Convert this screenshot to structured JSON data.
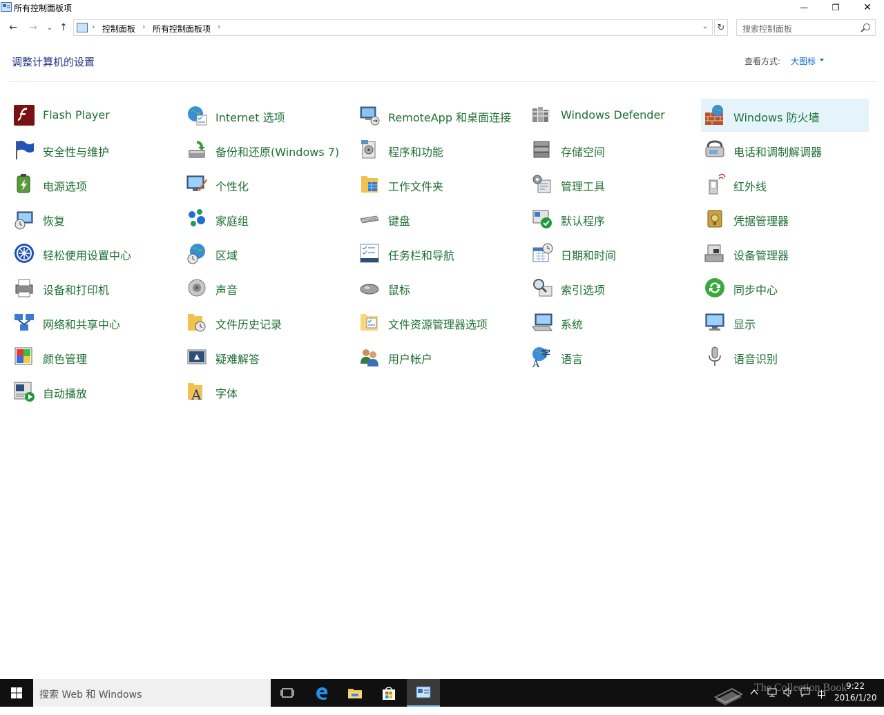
{
  "window": {
    "title": "所有控制面板项",
    "minimize": "—",
    "restore": "❐",
    "close": "✕"
  },
  "nav": {
    "back": "←",
    "forward": "→",
    "recent": "⌄",
    "up": "↑",
    "breadcrumb": [
      "控制面板",
      "所有控制面板项"
    ],
    "separator": "›",
    "dropdown": "⌄",
    "refresh": "↻",
    "search_placeholder": "搜索控制面板"
  },
  "header": {
    "title": "调整计算机的设置",
    "view_by_label": "查看方式:",
    "view_by_value": "大图标"
  },
  "items": [
    {
      "label": "Flash Player",
      "icon": "flash-player-icon"
    },
    {
      "label": "Internet 选项",
      "icon": "internet-options-icon"
    },
    {
      "label": "RemoteApp 和桌面连接",
      "icon": "remoteapp-icon"
    },
    {
      "label": "Windows Defender",
      "icon": "windows-defender-icon"
    },
    {
      "label": "Windows 防火墙",
      "icon": "firewall-icon",
      "highlighted": true
    },
    {
      "label": "安全性与维护",
      "icon": "security-flag-icon"
    },
    {
      "label": "备份和还原(Windows 7)",
      "icon": "backup-restore-icon"
    },
    {
      "label": "程序和功能",
      "icon": "programs-features-icon"
    },
    {
      "label": "存储空间",
      "icon": "storage-spaces-icon"
    },
    {
      "label": "电话和调制解调器",
      "icon": "phone-modem-icon"
    },
    {
      "label": "电源选项",
      "icon": "power-options-icon"
    },
    {
      "label": "个性化",
      "icon": "personalization-icon"
    },
    {
      "label": "工作文件夹",
      "icon": "work-folders-icon"
    },
    {
      "label": "管理工具",
      "icon": "admin-tools-icon"
    },
    {
      "label": "红外线",
      "icon": "infrared-icon"
    },
    {
      "label": "恢复",
      "icon": "recovery-icon"
    },
    {
      "label": "家庭组",
      "icon": "homegroup-icon"
    },
    {
      "label": "键盘",
      "icon": "keyboard-icon"
    },
    {
      "label": "默认程序",
      "icon": "default-programs-icon"
    },
    {
      "label": "凭据管理器",
      "icon": "credential-manager-icon"
    },
    {
      "label": "轻松使用设置中心",
      "icon": "ease-of-access-icon"
    },
    {
      "label": "区域",
      "icon": "region-icon"
    },
    {
      "label": "任务栏和导航",
      "icon": "taskbar-navigation-icon"
    },
    {
      "label": "日期和时间",
      "icon": "date-time-icon"
    },
    {
      "label": "设备管理器",
      "icon": "device-manager-icon"
    },
    {
      "label": "设备和打印机",
      "icon": "devices-printers-icon"
    },
    {
      "label": "声音",
      "icon": "sound-icon"
    },
    {
      "label": "鼠标",
      "icon": "mouse-icon"
    },
    {
      "label": "索引选项",
      "icon": "indexing-options-icon"
    },
    {
      "label": "同步中心",
      "icon": "sync-center-icon"
    },
    {
      "label": "网络和共享中心",
      "icon": "network-sharing-icon"
    },
    {
      "label": "文件历史记录",
      "icon": "file-history-icon"
    },
    {
      "label": "文件资源管理器选项",
      "icon": "file-explorer-options-icon"
    },
    {
      "label": "系统",
      "icon": "system-icon"
    },
    {
      "label": "显示",
      "icon": "display-icon"
    },
    {
      "label": "颜色管理",
      "icon": "color-management-icon"
    },
    {
      "label": "疑难解答",
      "icon": "troubleshooting-icon"
    },
    {
      "label": "用户帐户",
      "icon": "user-accounts-icon"
    },
    {
      "label": "语言",
      "icon": "language-icon"
    },
    {
      "label": "语音识别",
      "icon": "speech-recognition-icon"
    },
    {
      "label": "自动播放",
      "icon": "autoplay-icon"
    },
    {
      "label": "字体",
      "icon": "fonts-icon"
    }
  ],
  "taskbar": {
    "search_text": "搜索 Web 和 Windows",
    "time": "9:22",
    "date": "2016/1/20",
    "ime": "中",
    "watermark": "The Collection Book"
  }
}
